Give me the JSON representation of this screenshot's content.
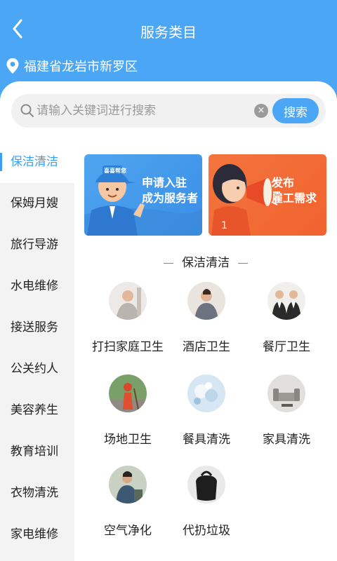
{
  "header": {
    "title": "服务类目"
  },
  "location": {
    "text": "福建省龙岩市新罗区"
  },
  "search": {
    "placeholder": "请输入关键词进行搜索",
    "clear_label": "×",
    "button_label": "搜索"
  },
  "sidebar": {
    "items": [
      {
        "label": "保洁清洁",
        "active": true
      },
      {
        "label": "保姆月嫂"
      },
      {
        "label": "旅行导游"
      },
      {
        "label": "水电维修"
      },
      {
        "label": "接送服务"
      },
      {
        "label": "公关约人"
      },
      {
        "label": "美容养生"
      },
      {
        "label": "教育培训"
      },
      {
        "label": "衣物清洗"
      },
      {
        "label": "家电维修"
      }
    ]
  },
  "banners": {
    "left": {
      "line1": "申请入驻",
      "line2": "成为服务者",
      "cap_text": "喜喜帮您"
    },
    "right": {
      "line1": "发布",
      "line2": "雇工需求"
    }
  },
  "section": {
    "title": "保洁清洁"
  },
  "services": [
    {
      "label": "打扫家庭卫生"
    },
    {
      "label": "酒店卫生"
    },
    {
      "label": "餐厅卫生"
    },
    {
      "label": "场地卫生"
    },
    {
      "label": "餐具清洗"
    },
    {
      "label": "家具清洗"
    },
    {
      "label": "空气净化"
    },
    {
      "label": "代扔垃圾"
    }
  ],
  "colors": {
    "primary": "#4ba6f5",
    "active_text": "#3e9ef2",
    "orange": "#f05a2a"
  }
}
